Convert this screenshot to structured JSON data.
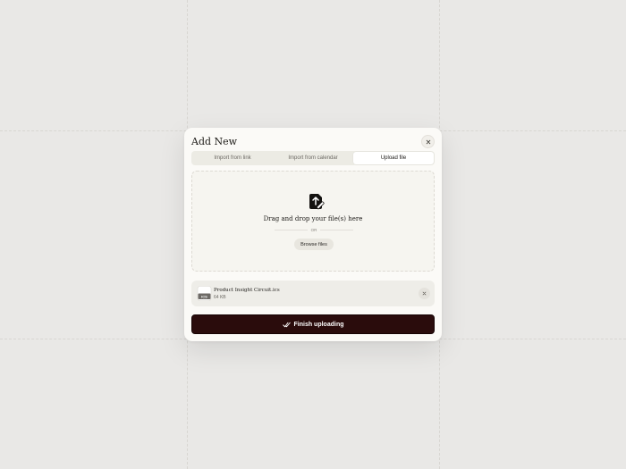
{
  "modal": {
    "title": "Add New",
    "close_icon": "close-icon"
  },
  "tabs": [
    {
      "label": "Import from link",
      "active": false
    },
    {
      "label": "Import from calendar",
      "active": false
    },
    {
      "label": "Upload file",
      "active": true
    }
  ],
  "dropzone": {
    "icon": "file-upload-icon",
    "text": "Drag and drop your file(s) here",
    "or_text": "OR",
    "browse_label": "Browse files"
  },
  "file": {
    "icon": "ics-file-icon",
    "icon_label": "ICS",
    "name": "Product Insight Circuit.ics",
    "size": "64 KB",
    "remove_icon": "close-icon"
  },
  "finish": {
    "icon": "double-check-icon",
    "label": "Finish uploading"
  },
  "colors": {
    "background": "#e9e8e6",
    "modal": "#fbfaf7",
    "primary_button": "#2a0c0c"
  }
}
